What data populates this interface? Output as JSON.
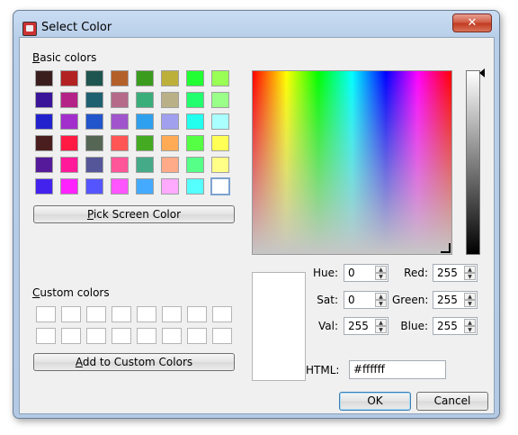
{
  "window": {
    "title": "Select Color",
    "close_label": "✕"
  },
  "basic_colors": {
    "label": "Basic colors",
    "swatches": [
      "#3a1e1e",
      "#b22222",
      "#1e5550",
      "#b4602a",
      "#3a9b1e",
      "#bdb03a",
      "#22ff33",
      "#99ff55",
      "#3a1499",
      "#b42288",
      "#1e6070",
      "#b46a88",
      "#3aae7a",
      "#bab088",
      "#22ff6e",
      "#99ff88",
      "#2222cc",
      "#a22ecc",
      "#2255cc",
      "#a055cc",
      "#2ea0ee",
      "#a0a0ee",
      "#22ffee",
      "#aaffff",
      "#4a1e1e",
      "#ff1a44",
      "#556655",
      "#ff5555",
      "#44aa22",
      "#ffaa55",
      "#55ff44",
      "#ffff55",
      "#551a99",
      "#ff1a99",
      "#555599",
      "#ff5599",
      "#44aa88",
      "#ffaa88",
      "#55ff88",
      "#ffff88",
      "#4422ee",
      "#ff22ff",
      "#5555ff",
      "#ff55ff",
      "#44aaff",
      "#ffaaff",
      "#55ffff",
      "#ffffff"
    ],
    "selected_index": 47
  },
  "buttons": {
    "pick_screen": "Pick Screen Color",
    "add_custom": "Add to Custom Colors",
    "ok": "OK",
    "cancel": "Cancel"
  },
  "custom_colors": {
    "label": "Custom colors",
    "count": 16
  },
  "fields": {
    "hue": {
      "label": "Hue:",
      "value": "0"
    },
    "sat": {
      "label": "Sat:",
      "value": "0"
    },
    "val": {
      "label": "Val:",
      "value": "255"
    },
    "red": {
      "label": "Red:",
      "value": "255"
    },
    "green": {
      "label": "Green:",
      "value": "255"
    },
    "blue": {
      "label": "Blue:",
      "value": "255"
    },
    "html": {
      "label": "HTML:",
      "value": "#ffffff"
    }
  },
  "current_color": "#ffffff"
}
